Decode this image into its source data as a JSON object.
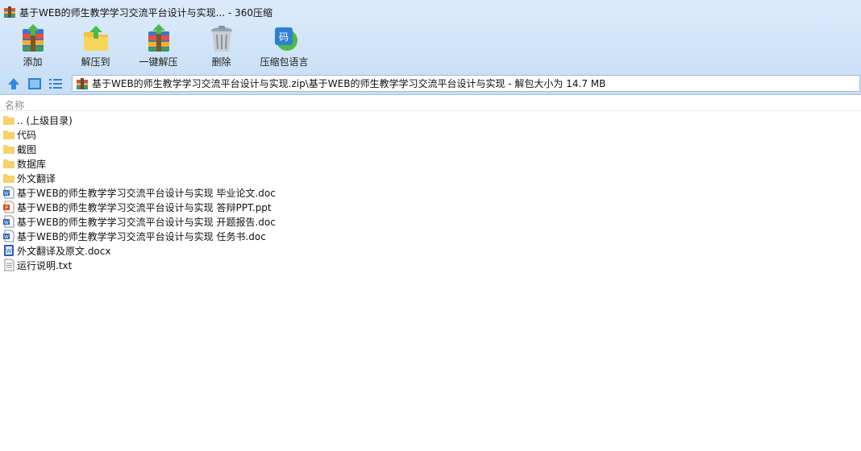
{
  "window": {
    "title": "基于WEB的师生教学学习交流平台设计与实现... - 360压缩"
  },
  "toolbar": {
    "items": [
      {
        "label": "添加",
        "icon": "add-archive-icon"
      },
      {
        "label": "解压到",
        "icon": "extract-to-icon"
      },
      {
        "label": "一键解压",
        "icon": "one-click-extract-icon"
      },
      {
        "label": "删除",
        "icon": "delete-trash-icon"
      },
      {
        "label": "压缩包语言",
        "icon": "archive-language-icon"
      }
    ]
  },
  "nav": {
    "up_icon": "up-arrow-icon",
    "view_icon": "view-mode-icon",
    "list_icon": "list-view-icon",
    "path": "基于WEB的师生教学学习交流平台设计与实现.zip\\基于WEB的师生教学学习交流平台设计与实现 - 解包大小为 14.7 MB"
  },
  "list": {
    "column_name": "名称",
    "files": [
      {
        "name": ".. (上级目录)",
        "type": "folder"
      },
      {
        "name": "代码",
        "type": "folder"
      },
      {
        "name": "截图",
        "type": "folder"
      },
      {
        "name": "数据库",
        "type": "folder"
      },
      {
        "name": "外文翻译",
        "type": "folder"
      },
      {
        "name": "基于WEB的师生教学学习交流平台设计与实现 毕业论文.doc",
        "type": "doc"
      },
      {
        "name": "基于WEB的师生教学学习交流平台设计与实现 答辩PPT.ppt",
        "type": "ppt"
      },
      {
        "name": "基于WEB的师生教学学习交流平台设计与实现 开题报告.doc",
        "type": "doc"
      },
      {
        "name": "基于WEB的师生教学学习交流平台设计与实现 任务书.doc",
        "type": "doc"
      },
      {
        "name": "外文翻译及原文.docx",
        "type": "docx"
      },
      {
        "name": "运行说明.txt",
        "type": "txt"
      }
    ]
  },
  "colors": {
    "toolbar_bg": "#cfe3f8",
    "folder": "#f7d26a",
    "doc": "#2b5fb4",
    "ppt": "#d2521f"
  }
}
